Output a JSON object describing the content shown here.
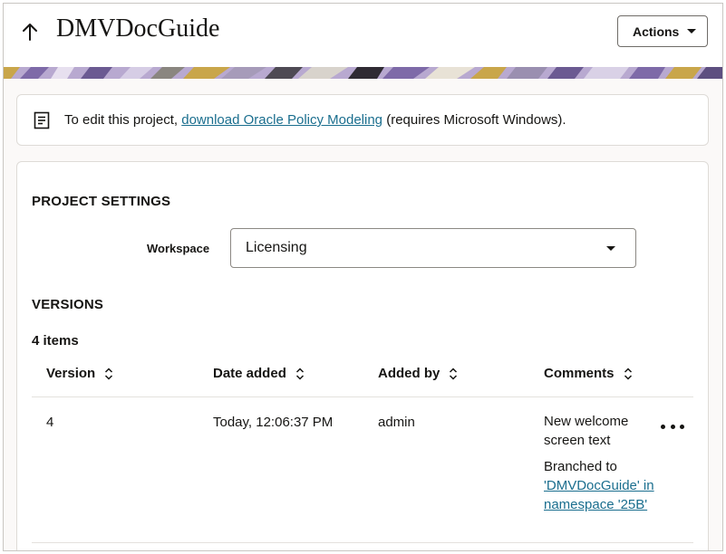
{
  "header": {
    "title": "DMVDocGuide",
    "actions_label": "Actions"
  },
  "info": {
    "prefix": "To edit this project, ",
    "link": "download Oracle Policy Modeling",
    "suffix": " (requires Microsoft Windows)."
  },
  "settings": {
    "heading": "PROJECT SETTINGS",
    "workspace_label": "Workspace",
    "workspace_value": "Licensing"
  },
  "versions": {
    "heading": "VERSIONS",
    "count_label": "4 items",
    "columns": [
      "Version",
      "Date added",
      "Added by",
      "Comments"
    ],
    "rows": [
      {
        "version": "4",
        "date_added": "Today, 12:06:37 PM",
        "added_by": "admin",
        "comment": "New welcome screen text",
        "branch_prefix": "Branched to",
        "branch_link": "'DMVDocGuide' in namespace '25B'"
      }
    ]
  },
  "colors": {
    "link": "#1a6e8e",
    "banner_purple": "#7e6aa8",
    "banner_gold": "#c9a64a"
  }
}
